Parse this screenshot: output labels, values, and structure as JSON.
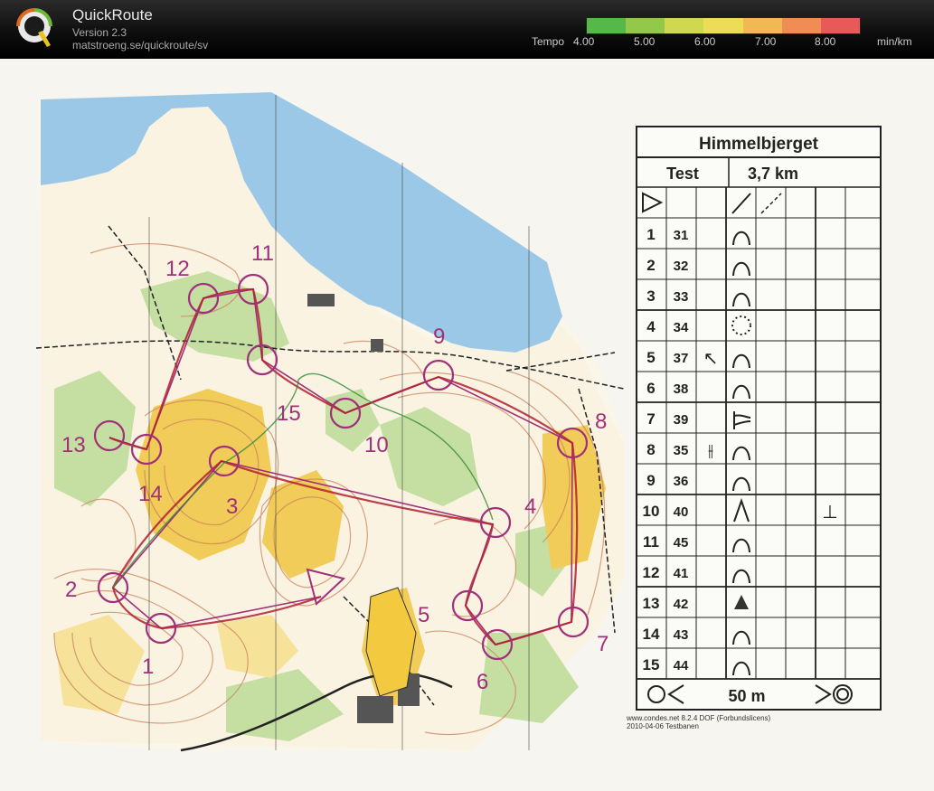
{
  "app": {
    "name": "QuickRoute",
    "version": "Version 2.3",
    "url": "matstroeng.se/quickroute/sv"
  },
  "tempo_scale": {
    "label": "Tempo",
    "ticks": [
      "4.00",
      "5.00",
      "6.00",
      "7.00",
      "8.00"
    ],
    "unit": "min/km",
    "colors": [
      "#55b848",
      "#94c84a",
      "#cfd84e",
      "#eddc55",
      "#f2b853",
      "#ef8d55",
      "#e85a5a"
    ]
  },
  "map": {
    "control_numbers": [
      "1",
      "2",
      "3",
      "4",
      "5",
      "6",
      "7",
      "8",
      "9",
      "10",
      "11",
      "12",
      "13",
      "14",
      "15"
    ],
    "colors": {
      "water": "#9cc8e8",
      "forest": "#c8dfa8",
      "open": "#f0c850",
      "contour": "#c9835a",
      "course": "#a0307a",
      "route": "#b02030"
    }
  },
  "description_sheet": {
    "event": "Himmelbjerget",
    "class": "Test",
    "distance": "3,7 km",
    "rows": [
      {
        "n": "1",
        "code": "31",
        "feature": "knoll"
      },
      {
        "n": "2",
        "code": "32",
        "feature": "knoll"
      },
      {
        "n": "3",
        "code": "33",
        "feature": "knoll"
      },
      {
        "n": "4",
        "code": "34",
        "feature": "thicket"
      },
      {
        "n": "5",
        "code": "37",
        "feature": "knoll",
        "dir": "↖"
      },
      {
        "n": "6",
        "code": "38",
        "feature": "knoll"
      },
      {
        "n": "7",
        "code": "39",
        "feature": "fork"
      },
      {
        "n": "8",
        "code": "35",
        "feature": "knoll",
        "pos": "⫲"
      },
      {
        "n": "9",
        "code": "36",
        "feature": "knoll"
      },
      {
        "n": "10",
        "code": "40",
        "feature": "spur",
        "extra": "⊥"
      },
      {
        "n": "11",
        "code": "45",
        "feature": "knoll"
      },
      {
        "n": "12",
        "code": "41",
        "feature": "knoll"
      },
      {
        "n": "13",
        "code": "42",
        "feature": "boulder"
      },
      {
        "n": "14",
        "code": "43",
        "feature": "knoll"
      },
      {
        "n": "15",
        "code": "44",
        "feature": "knoll"
      }
    ],
    "finish_distance": "50 m",
    "footer_line1": "www.condes.net 8.2.4 DOF (Forbundslicens)",
    "footer_line2": "2010-04-06 Testbanen"
  }
}
